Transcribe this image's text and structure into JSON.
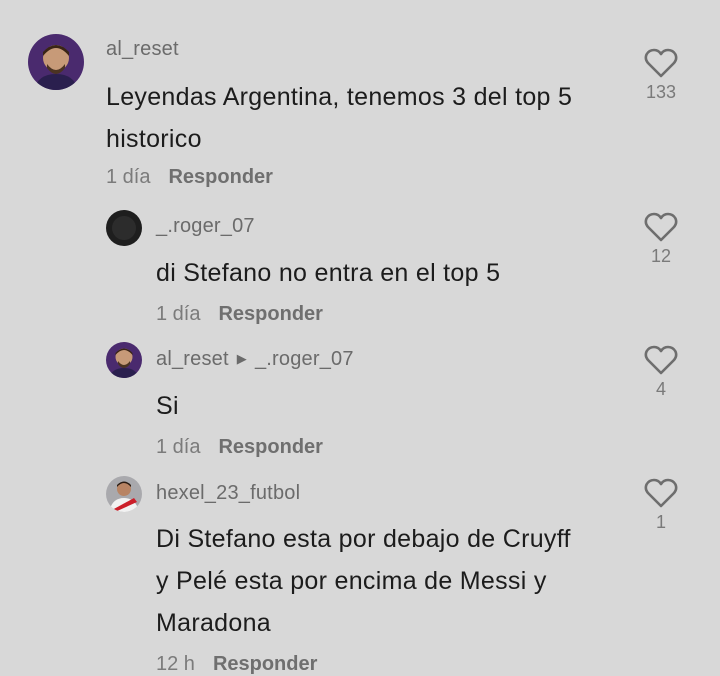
{
  "comments": [
    {
      "username": "al_reset",
      "text_lines": [
        "Leyendas Argentina, tenemos 3 del top 5",
        "historico"
      ],
      "time": "1 día",
      "reply_label": "Responder",
      "likes": "133",
      "avatar": "messi-portrait-purple"
    },
    {
      "username": "_.roger_07",
      "text_lines": [
        "di Stefano no entra en el top 5"
      ],
      "time": "1 día",
      "reply_label": "Responder",
      "likes": "12",
      "avatar": "dark-circle"
    },
    {
      "username": "al_reset",
      "reply_to": "_.roger_07",
      "text_lines": [
        "Si"
      ],
      "time": "1 día",
      "reply_label": "Responder",
      "likes": "4",
      "avatar": "messi-portrait-purple"
    },
    {
      "username": "hexel_23_futbol",
      "text_lines": [
        "Di Stefano esta por debajo de Cruyff",
        "y Pelé esta por encima de Messi y",
        "Maradona"
      ],
      "time": "12 h",
      "reply_label": "Responder",
      "likes": "1",
      "avatar": "player-red-white"
    }
  ],
  "icons": {
    "like": "heart-outline-icon",
    "reply_arrow": "caret-right-icon"
  },
  "colors": {
    "background": "#d8d8d8",
    "text": "#1c1c1c",
    "muted": "#7b7b7b"
  }
}
